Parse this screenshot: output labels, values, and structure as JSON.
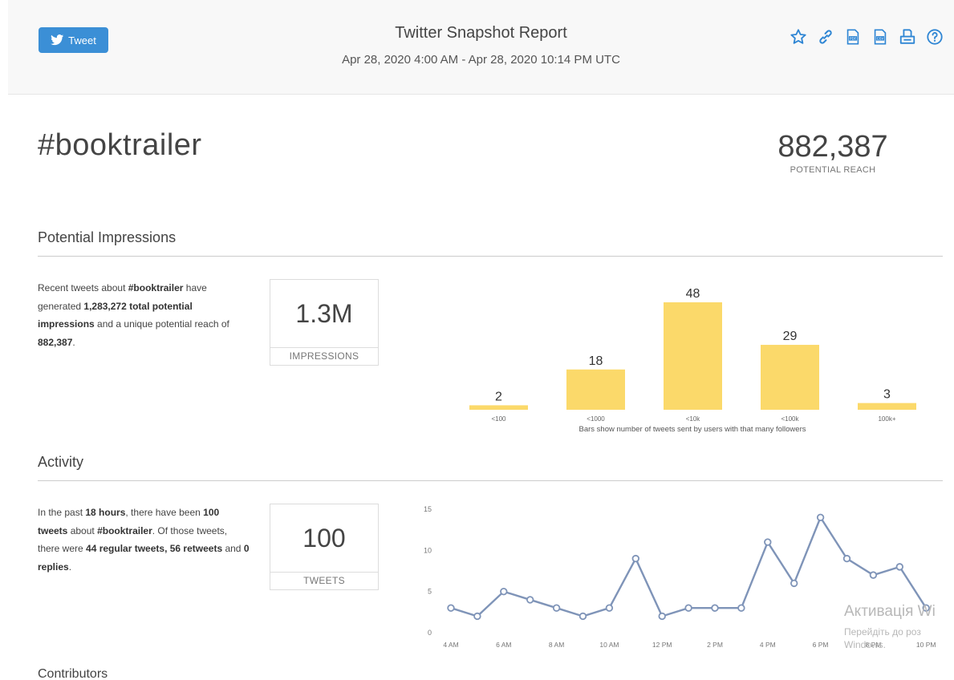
{
  "header": {
    "tweet_label": "Tweet",
    "title": "Twitter Snapshot Report",
    "date_range": "Apr 28, 2020 4:00 AM - Apr 28, 2020 10:14 PM UTC",
    "tools": [
      "star-icon",
      "link-icon",
      "pdf-icon",
      "csv-icon",
      "print-icon",
      "help-icon"
    ],
    "accent": "#3b8fd6"
  },
  "topic": {
    "hashtag": "#booktrailer",
    "reach_value": "882,387",
    "reach_label": "POTENTIAL REACH"
  },
  "impressions": {
    "title": "Potential Impressions",
    "desc": {
      "t1": "Recent tweets about ",
      "b1": "#booktrailer",
      "t2": " have generated ",
      "b2": "1,283,272 total potential impressions",
      "t3": " and a unique potential reach of ",
      "b3": "882,387",
      "t4": "."
    },
    "stat_value": "1.3M",
    "stat_label": "IMPRESSIONS"
  },
  "activity": {
    "title": "Activity",
    "desc": {
      "t1": "In the past ",
      "b1": "18 hours",
      "t2": ", there have been ",
      "b2": "100 tweets",
      "t3": " about ",
      "b3": "#booktrailer",
      "t4": ". Of those tweets, there were ",
      "b4": "44 regular tweets, 56 retweets",
      "t5": " and ",
      "b5": "0 replies",
      "t6": "."
    },
    "stat_value": "100",
    "stat_label": "TWEETS"
  },
  "contributors": {
    "title": "Contributors"
  },
  "watermark": {
    "line1": "Активація Wi",
    "line2": "Перейдіть до роз",
    "line3": "Windows."
  },
  "chart_data": [
    {
      "type": "bar",
      "categories": [
        "<100",
        "<1000",
        "<10k",
        "<100k",
        "100k+"
      ],
      "values": [
        2,
        18,
        48,
        29,
        3
      ],
      "caption": "Bars show number of tweets sent by users with that many followers",
      "color": "#fbd96a"
    },
    {
      "type": "line",
      "x": [
        "4 AM",
        "5 AM",
        "6 AM",
        "7 AM",
        "8 AM",
        "9 AM",
        "10 AM",
        "11 AM",
        "12 PM",
        "1 PM",
        "2 PM",
        "3 PM",
        "4 PM",
        "5 PM",
        "6 PM",
        "7 PM",
        "8 PM",
        "9 PM",
        "10 PM"
      ],
      "x_tick_labels": [
        "4 AM",
        "6 AM",
        "8 AM",
        "10 AM",
        "12 PM",
        "2 PM",
        "4 PM",
        "6 PM",
        "8 PM",
        "10 PM"
      ],
      "y": [
        3,
        2,
        5,
        4,
        3,
        2,
        3,
        9,
        2,
        3,
        3,
        3,
        11,
        6,
        14,
        9,
        7,
        8,
        3
      ],
      "ylim": [
        0,
        15
      ],
      "y_ticks": [
        0,
        5,
        10,
        15
      ],
      "color": "#7f94b8"
    }
  ]
}
